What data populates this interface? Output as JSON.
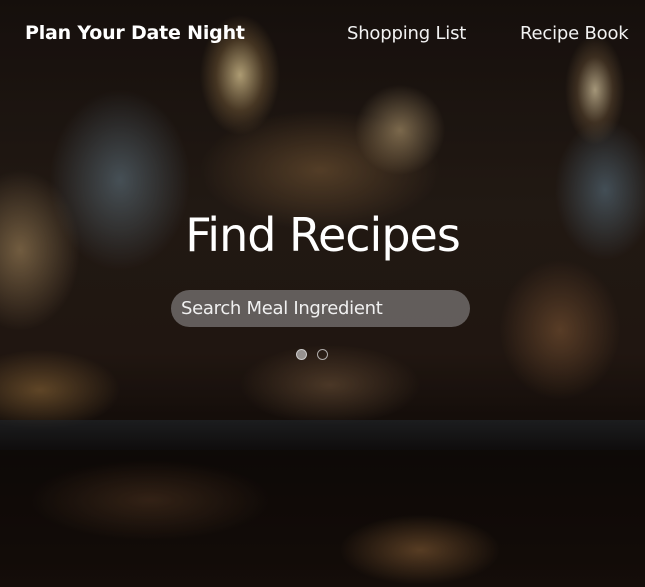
{
  "nav": {
    "brand": "Plan Your Date Night",
    "links": [
      {
        "label": "Shopping List"
      },
      {
        "label": "Recipe Book"
      }
    ]
  },
  "hero": {
    "title": "Find Recipes",
    "search": {
      "placeholder": "Search Meal Ingredient",
      "value": ""
    }
  },
  "carousel": {
    "total_slides": 2,
    "active_slide": 1
  },
  "colors": {
    "text": "#ffffff",
    "search_bg": "rgba(190,190,195,0.42)"
  }
}
